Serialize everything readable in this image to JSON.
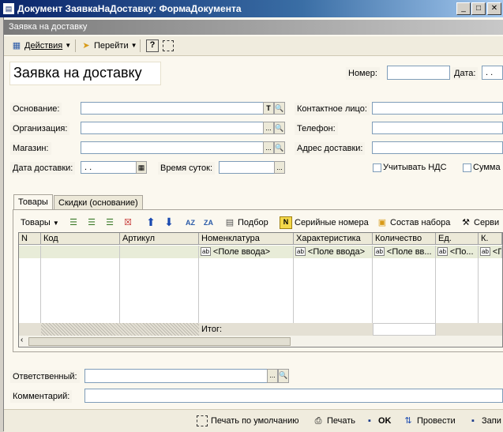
{
  "window": {
    "title": "Документ ЗаявкаНаДоставку: ФормаДокумента",
    "min_label": "_",
    "max_label": "□",
    "close_label": "✕"
  },
  "inner_title": "Заявка на доставку",
  "toolbar": {
    "actions_label": "Действия",
    "goto_label": "Перейти",
    "help_label": "?"
  },
  "form": {
    "heading": "Заявка на доставку",
    "number_label": "Номер:",
    "number_value": "",
    "date_label": "Дата:",
    "date_value": ". .",
    "osnovanie_label": "Основание:",
    "organization_label": "Организация:",
    "shop_label": "Магазин:",
    "delivery_date_label": "Дата доставки:",
    "delivery_date_value": ". .",
    "time_of_day_label": "Время суток:",
    "contact_label": "Контактное лицо:",
    "phone_label": "Телефон:",
    "address_label": "Адрес доставки:",
    "vat_label": "Учитывать НДС",
    "sum_label": "Сумма",
    "t_button": "T",
    "ellipsis": "..."
  },
  "tabs": [
    {
      "label": "Товары"
    },
    {
      "label": "Скидки (основание)"
    }
  ],
  "grid_toolbar": {
    "goods_menu": "Товары",
    "podbor": "Подбор",
    "serial": "Серийные номера",
    "set_composition": "Состав набора",
    "service": "Серви"
  },
  "grid": {
    "columns": [
      "N",
      "Код",
      "Артикул",
      "Номенклатура",
      "Характеристика",
      "Количество",
      "Ед.",
      "К."
    ],
    "row1": [
      "<Поле ввода>",
      "<Поле ввода>",
      "<Поле вв...",
      "<По...",
      "<П"
    ],
    "ab_icon": "ab",
    "total_label": "Итог:"
  },
  "bottom_fields": {
    "responsible_label": "Ответственный:",
    "comment_label": "Комментарий:",
    "ellipsis": "..."
  },
  "bottom_bar": {
    "print_default": "Печать по умолчанию",
    "print": "Печать",
    "ok": "OK",
    "post": "Провести",
    "write": "Запи"
  },
  "colors": {
    "title_bar": "#0a246a",
    "form_bg": "#fbf8ef",
    "selected_row": "#e8ecd8"
  }
}
